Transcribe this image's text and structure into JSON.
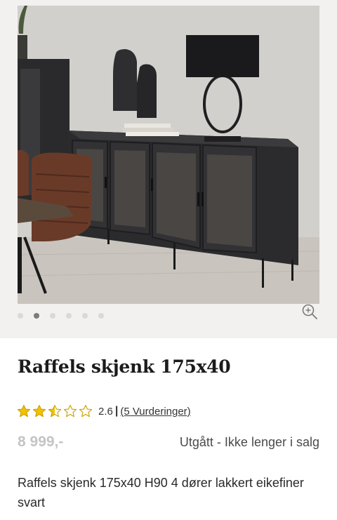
{
  "gallery": {
    "image_label": "Raffels skjenk 175x40 product photo",
    "slide_count": 6,
    "active_slide": 1
  },
  "product": {
    "title": "Raffels skjenk 175x40",
    "rating": {
      "value": "2.6",
      "score": 2.6,
      "max": 5,
      "separator": "|",
      "reviews_text": "(5 Vurderinger)"
    },
    "price": "8 999,-",
    "availability": "Utgått - Ikke lenger i salg",
    "description": "Raffels skjenk 175x40 H90 4 dører lakkert eikefiner svart"
  },
  "colors": {
    "star_fill": "#f5c000",
    "star_outline": "#c9a300",
    "price": "#c4c4c4",
    "background_gallery": "#f2f1ef",
    "dot_active": "#7b7b7b",
    "dot_inactive": "#dad9d6"
  },
  "icons": {
    "zoom": "zoom-in-icon",
    "star": "star-icon"
  }
}
